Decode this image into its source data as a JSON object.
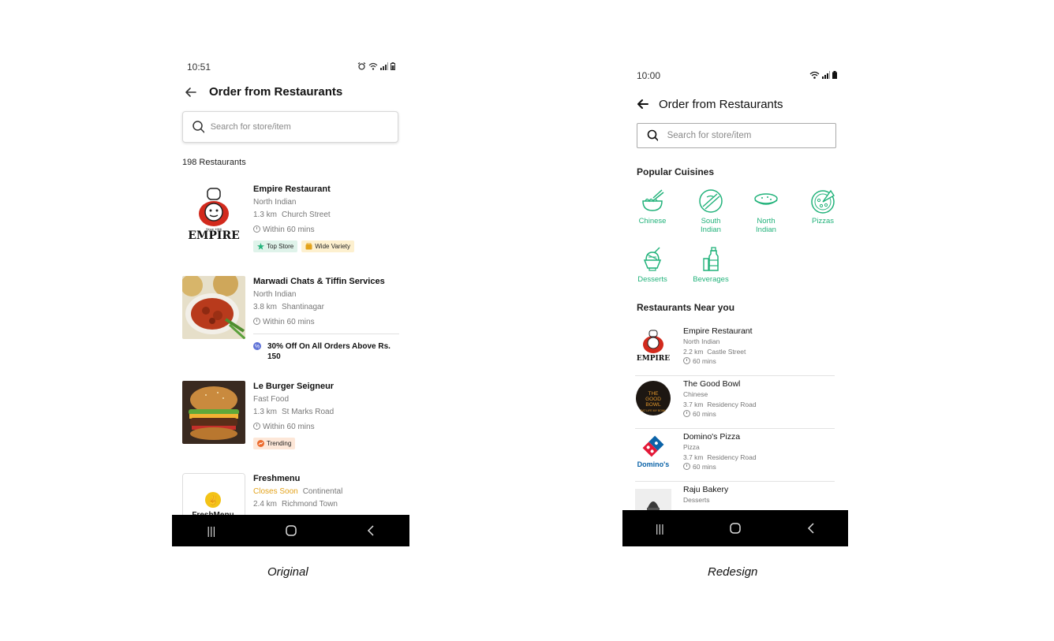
{
  "original": {
    "status_time": "10:51",
    "title": "Order from Restaurants",
    "search_placeholder": "Search for store/item",
    "count_label": "198 Restaurants",
    "restaurants": [
      {
        "name": "Empire Restaurant",
        "cuisine": "North Indian",
        "distance": "1.3 km",
        "area": "Church Street",
        "eta": "Within 60 mins",
        "tags": [
          "Top Store",
          "Wide Variety"
        ],
        "logo_text": "EMPIRE",
        "logo_since": "Since 1966"
      },
      {
        "name": "Marwadi Chats & Tiffin Services",
        "cuisine": "North Indian",
        "distance": "3.8 km",
        "area": "Shantinagar",
        "eta": "Within 60 mins",
        "offer": "30% Off On All Orders Above Rs. 150"
      },
      {
        "name": "Le Burger Seigneur",
        "cuisine": "Fast Food",
        "distance": "1.3 km",
        "area": "St Marks Road",
        "eta": "Within 60 mins",
        "tags": [
          "Trending"
        ]
      },
      {
        "name": "Freshmenu",
        "status": "Closes Soon",
        "cuisine": "Continental",
        "distance": "2.4 km",
        "area": "Richmond Town",
        "logo_text": "FreshMenu"
      }
    ],
    "caption": "Original"
  },
  "redesign": {
    "status_time": "10:00",
    "title": "Order from Restaurants",
    "search_placeholder": "Search for store/item",
    "popular_title": "Popular Cuisines",
    "cuisines": [
      {
        "label": "Chinese",
        "icon": "noodle-bowl-icon"
      },
      {
        "label": "South Indian",
        "icon": "dosa-icon"
      },
      {
        "label": "North Indian",
        "icon": "roti-icon"
      },
      {
        "label": "Pizzas",
        "icon": "pizza-icon"
      },
      {
        "label": "Desserts",
        "icon": "ice-cream-icon"
      },
      {
        "label": "Beverages",
        "icon": "bottle-icon"
      }
    ],
    "near_title": "Restaurants Near you",
    "restaurants": [
      {
        "name": "Empire Restaurant",
        "cuisine": "North Indian",
        "distance": "2.2 km",
        "area": "Castle Street",
        "eta": "60 mins",
        "logo_text": "EMPIRE"
      },
      {
        "name": "The Good Bowl",
        "cuisine": "Chinese",
        "distance": "3.7 km",
        "area": "Residency Road",
        "eta": "60 mins",
        "logo_text": "THE GOOD BOWL",
        "logo_sub": "EAT LIFE MY BOWL"
      },
      {
        "name": "Domino's Pizza",
        "cuisine": "Pizza",
        "distance": "3.7 km",
        "area": "Residency Road",
        "eta": "60 mins",
        "logo_text": "Domino's"
      },
      {
        "name": "Raju Bakery",
        "cuisine": "Desserts"
      }
    ],
    "caption": "Redesign"
  },
  "colors": {
    "accent_green": "#21b27a",
    "closes_soon": "#e3a21a",
    "top_store_bg": "#dff3ea",
    "wide_variety_bg": "#fdf0cf",
    "trending_bg": "#fde7d8",
    "offer_icon": "#5b6fd6"
  }
}
